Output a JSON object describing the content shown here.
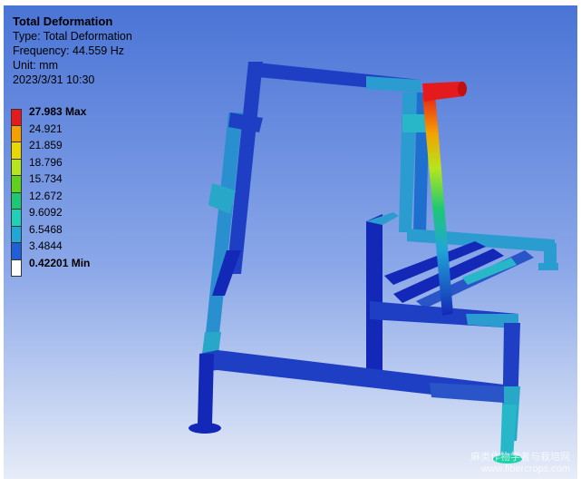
{
  "result": {
    "title": "Total Deformation",
    "type_line": "Type: Total Deformation",
    "frequency_line": "Frequency: 44.559 Hz",
    "unit_line": "Unit: mm",
    "date_line": "2023/3/31 10:30"
  },
  "legend": {
    "entries": [
      {
        "label": "27.983 Max",
        "color": "#e41a1c",
        "bold": true
      },
      {
        "label": "24.921",
        "color": "#f5a000",
        "bold": false
      },
      {
        "label": "21.859",
        "color": "#e8d800",
        "bold": false
      },
      {
        "label": "18.796",
        "color": "#b5e61d",
        "bold": false
      },
      {
        "label": "15.734",
        "color": "#5ed11c",
        "bold": false
      },
      {
        "label": "12.672",
        "color": "#1ec873",
        "bold": false
      },
      {
        "label": "9.6092",
        "color": "#1fd1b8",
        "bold": false
      },
      {
        "label": "6.5468",
        "color": "#20a7d6",
        "bold": false
      },
      {
        "label": "3.4844",
        "color": "#1f5fd8",
        "bold": false
      },
      {
        "label": "0.42201 Min",
        "color": "#ffffff",
        "bold": true
      }
    ]
  },
  "colors": {
    "frame_dark": "#1428b8",
    "frame_mid": "#2a55c8",
    "frame_light": "#2b9ccf",
    "frame_cyan": "#28b7c8"
  },
  "watermark": {
    "line1": "麻类作物学者与栽培网",
    "line2": "www.fibercrops.com"
  }
}
